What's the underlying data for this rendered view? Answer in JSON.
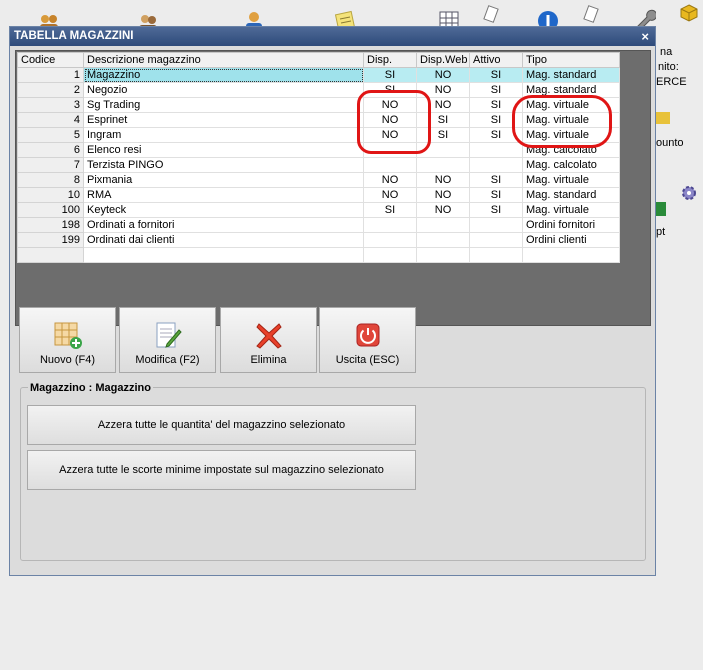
{
  "desktop": {
    "side_texts": [
      "na",
      "nito:",
      "ERCE",
      "ounto",
      "pt"
    ]
  },
  "window": {
    "title": "TABELLA MAGAZZINI",
    "close_glyph": "×"
  },
  "grid": {
    "columns": [
      "Codice",
      "Descrizione magazzino",
      "Disp.",
      "Disp.Web",
      "Attivo",
      "Tipo"
    ],
    "rows": [
      {
        "code": "1",
        "desc": "Magazzino",
        "disp": "SI",
        "web": "NO",
        "attivo": "SI",
        "tipo": "Mag. standard"
      },
      {
        "code": "2",
        "desc": "Negozio",
        "disp": "SI",
        "web": "NO",
        "attivo": "SI",
        "tipo": "Mag. standard"
      },
      {
        "code": "3",
        "desc": "Sg Trading",
        "disp": "NO",
        "web": "NO",
        "attivo": "SI",
        "tipo": "Mag. virtuale"
      },
      {
        "code": "4",
        "desc": "Esprinet",
        "disp": "NO",
        "web": "SI",
        "attivo": "SI",
        "tipo": "Mag. virtuale"
      },
      {
        "code": "5",
        "desc": "Ingram",
        "disp": "NO",
        "web": "SI",
        "attivo": "SI",
        "tipo": "Mag. virtuale"
      },
      {
        "code": "6",
        "desc": "Elenco resi",
        "disp": "",
        "web": "",
        "attivo": "",
        "tipo": "Mag. calcolato"
      },
      {
        "code": "7",
        "desc": "Terzista PINGO",
        "disp": "",
        "web": "",
        "attivo": "",
        "tipo": "Mag. calcolato"
      },
      {
        "code": "8",
        "desc": "Pixmania",
        "disp": "NO",
        "web": "NO",
        "attivo": "SI",
        "tipo": "Mag. virtuale"
      },
      {
        "code": "10",
        "desc": "RMA",
        "disp": "NO",
        "web": "NO",
        "attivo": "SI",
        "tipo": "Mag. standard"
      },
      {
        "code": "100",
        "desc": "Keyteck",
        "disp": "SI",
        "web": "NO",
        "attivo": "SI",
        "tipo": "Mag. virtuale"
      },
      {
        "code": "198",
        "desc": "Ordinati a fornitori",
        "disp": "",
        "web": "",
        "attivo": "",
        "tipo": "Ordini fornitori"
      },
      {
        "code": "199",
        "desc": "Ordinati dai clienti",
        "disp": "",
        "web": "",
        "attivo": "",
        "tipo": "Ordini clienti"
      }
    ]
  },
  "toolbar": {
    "new_label": "Nuovo (F4)",
    "edit_label": "Modifica (F2)",
    "delete_label": "Elimina",
    "exit_label": "Uscita (ESC)"
  },
  "group": {
    "title": "Magazzino : Magazzino",
    "reset_qty_label": "Azzera tutte le quantita' del magazzino selezionato",
    "reset_min_label": "Azzera tutte le scorte minime impostate sul magazzino selezionato"
  },
  "colors": {
    "title_bar": "#2d4a7a",
    "selected_row": "#b8ecf2",
    "annotation": "#e01515"
  }
}
